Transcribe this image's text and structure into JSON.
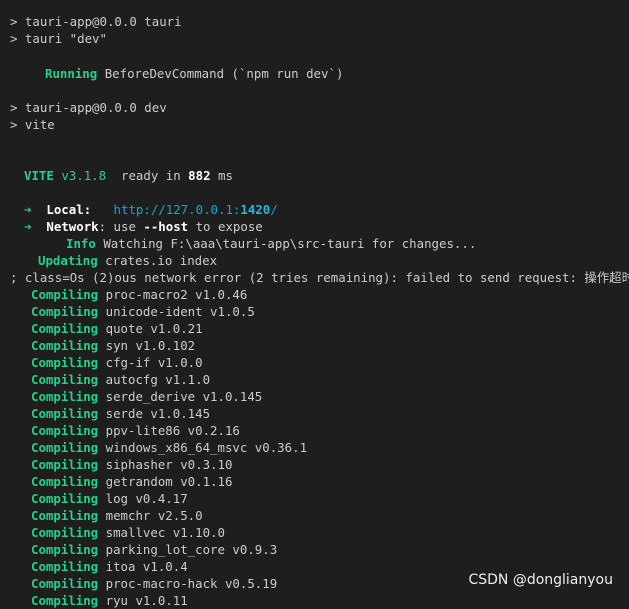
{
  "header": [
    "> tauri-app@0.0.0 tauri",
    "> tauri \"dev\""
  ],
  "running": {
    "word": "Running",
    "text": "BeforeDevCommand (`npm run dev`)"
  },
  "npm": [
    "> tauri-app@0.0.0 dev",
    "> vite"
  ],
  "vite": {
    "name": "VITE",
    "version": "v3.1.8",
    "ready_text": "ready in",
    "ms_value": "882",
    "ms_unit": "ms"
  },
  "local": {
    "arrow": "➜",
    "label": "Local:",
    "url_prefix": "http://127.0.0.1:",
    "port": "1420",
    "url_suffix": "/"
  },
  "network": {
    "arrow": "➜",
    "label": "Network",
    "text_before": ": use ",
    "flag": "--host",
    "text_after": " to expose"
  },
  "info": {
    "word": "Info",
    "text": "Watching F:\\aaa\\tauri-app\\src-tauri for changes..."
  },
  "error_line": "; class=Os (2)ous network error (2 tries remaining): failed to send request: 操作超时",
  "updating": {
    "word": "Updating",
    "text": "crates.io index"
  },
  "compiling_word": "Compiling",
  "compiling": [
    "proc-macro2 v1.0.46",
    "unicode-ident v1.0.5",
    "quote v1.0.21",
    "syn v1.0.102",
    "cfg-if v1.0.0",
    "autocfg v1.1.0",
    "serde_derive v1.0.145",
    "serde v1.0.145",
    "ppv-lite86 v0.2.16",
    "windows_x86_64_msvc v0.36.1",
    "siphasher v0.3.10",
    "getrandom v0.1.16",
    "log v0.4.17",
    "memchr v2.5.0",
    "smallvec v1.10.0",
    "parking_lot_core v0.9.3",
    "itoa v1.0.4",
    "proc-macro-hack v0.5.19",
    "ryu v1.0.11"
  ],
  "watermark": "CSDN @donglianyou",
  "colors": {
    "background": "#1e1e1e",
    "text": "#cccccc",
    "green": "#23d18b",
    "blue": "#3b8eea",
    "cyan": "#29b8db"
  }
}
